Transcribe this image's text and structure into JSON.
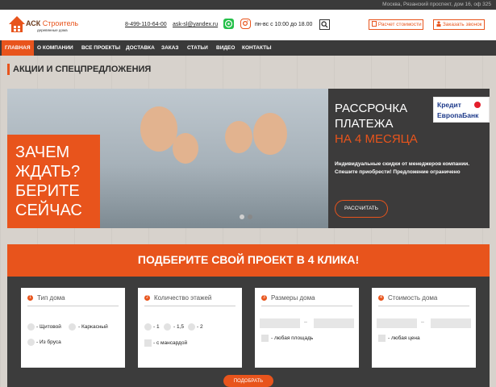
{
  "topbar": {
    "address": "Москва, Рязанский проспект, дом 16, оф 325"
  },
  "logo": {
    "brand_main": "АСК",
    "brand_accent": "Строитель",
    "tagline": "деревянные дома"
  },
  "header": {
    "phone": "8-499-110-64-00",
    "email": "ask-sl@yandex.ru",
    "hours": "пн-вс с 10:00 до 18.00",
    "calc_button": "Расчет стоимости",
    "call_button": "Заказать звонок"
  },
  "nav": {
    "items": [
      "ГЛАВНАЯ",
      "О КОМПАНИИ",
      "ВСЕ ПРОЕКТЫ",
      "ДОСТАВКА",
      "ЗАКАЗ",
      "СТАТЬИ",
      "ВИДЕО",
      "КОНТАКТЫ"
    ]
  },
  "section": {
    "title": "АКЦИИ И СПЕЦПРЕДЛОЖЕНИЯ"
  },
  "hero": {
    "left_lines": [
      "ЗАЧЕМ",
      "ЖДАТЬ?",
      "БЕРИТЕ",
      "СЕЙЧАС"
    ],
    "right_line1": "РАССРОЧКА",
    "right_line2": "ПЛАТЕЖА",
    "right_line3": "НА 4 МЕСЯЦА",
    "bank_line1": "Кредит",
    "bank_line2": "ЕвропаБанк",
    "promo_text": "Индивидуальные скидки от менеджеров компании. Спешите приобрести! Предложение ограничено",
    "promo_button": "РАССЧИТАТЬ"
  },
  "filter": {
    "title": "ПОДБЕРИТЕ СВОЙ ПРОЕКТ В 4 КЛИКА!",
    "cards": [
      {
        "num": "1",
        "title": "Тип дома",
        "options": [
          "- Щитовой",
          "- Каркасный",
          "- Из бруса"
        ]
      },
      {
        "num": "2",
        "title": "Количество этажей",
        "options": [
          "- 1",
          "- 1,5",
          "- 2"
        ],
        "checkbox": "- с мансардой"
      },
      {
        "num": "3",
        "title": "Размеры дома",
        "range_sep": "–",
        "checkbox": "- любая площадь"
      },
      {
        "num": "4",
        "title": "Стоимость дома",
        "range_sep": "–",
        "checkbox": "- любая цена"
      }
    ],
    "submit": "ПОДОБРАТЬ"
  },
  "colors": {
    "accent": "#e8541c",
    "dark": "#3c3c3c",
    "brand_brown": "#6b3b1e"
  }
}
